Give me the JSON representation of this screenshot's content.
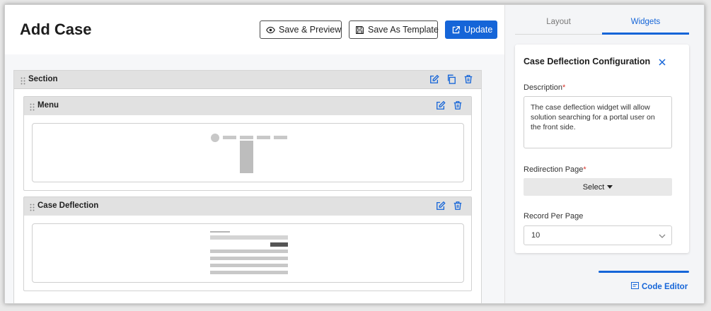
{
  "header": {
    "title": "Add Case",
    "save_preview_label": "Save & Preview",
    "save_template_label": "Save As Template",
    "update_label": "Update"
  },
  "canvas": {
    "section_label": "Section",
    "widgets": [
      {
        "label": "Menu"
      },
      {
        "label": "Case Deflection"
      }
    ]
  },
  "panel": {
    "tabs": [
      {
        "label": "Layout",
        "active": false
      },
      {
        "label": "Widgets",
        "active": true
      }
    ],
    "config": {
      "title": "Case Deflection Configuration",
      "description_label": "Description",
      "description_value": "The case deflection widget will allow solution searching for a portal user on the front side.",
      "redirection_label": "Redirection Page",
      "redirection_select": "Select",
      "record_label": "Record Per Page",
      "record_value": "10"
    },
    "code_editor_label": "Code Editor"
  },
  "colors": {
    "accent": "#1565d8",
    "required": "#d9342b",
    "bar_gray": "#e1e1e1"
  },
  "icons": [
    "eye-icon",
    "floppy-icon",
    "external-link-icon",
    "edit-icon",
    "copy-icon",
    "trash-icon",
    "drag-handle-icon",
    "close-icon",
    "caret-down-icon",
    "chevron-down-icon",
    "code-icon"
  ]
}
